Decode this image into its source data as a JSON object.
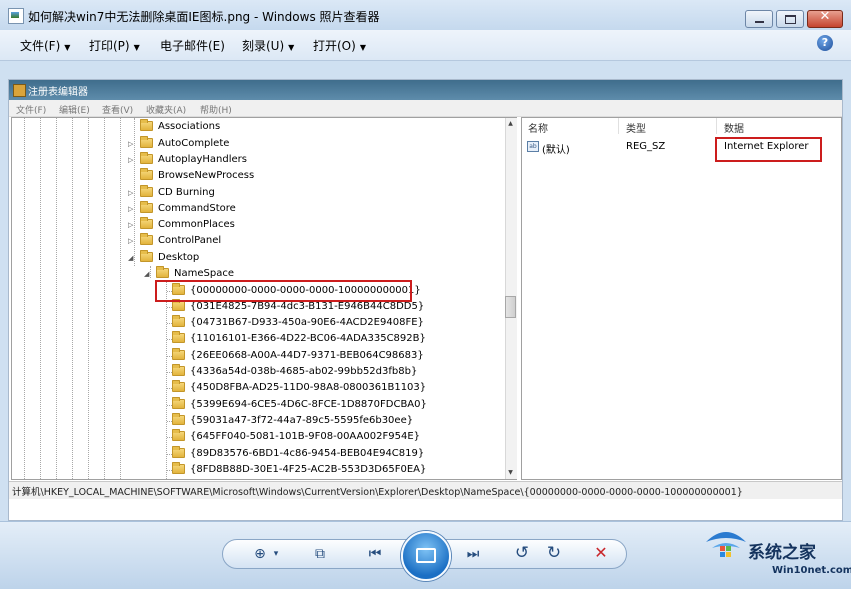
{
  "window": {
    "title": "如何解决win7中无法删除桌面IE图标.png - Windows 照片查看器",
    "close_glyph": "✕"
  },
  "menu": {
    "file": "文件(F)",
    "print": "打印(P)",
    "email": "电子邮件(E)",
    "burn": "刻录(U)",
    "open": "打开(O)",
    "arrow": "▼",
    "help": "?"
  },
  "registry": {
    "title": "注册表编辑器",
    "menu": [
      "文件(F)",
      "编辑(E)",
      "查看(V)",
      "收藏夹(A)",
      "帮助(H)"
    ],
    "tree_items": [
      "Associations",
      "AutoComplete",
      "AutoplayHandlers",
      "BrowseNewProcess",
      "CD Burning",
      "CommandStore",
      "CommonPlaces",
      "ControlPanel",
      "Desktop",
      "NameSpace",
      "{00000000-0000-0000-0000-100000000001}",
      "{031E4825-7B94-4dc3-B131-E946B44C8DD5}",
      "{04731B67-D933-450a-90E6-4ACD2E9408FE}",
      "{11016101-E366-4D22-BC06-4ADA335C892B}",
      "{26EE0668-A00A-44D7-9371-BEB064C98683}",
      "{4336a54d-038b-4685-ab02-99bb52d3fb8b}",
      "{450D8FBA-AD25-11D0-98A8-0800361B1103}",
      "{5399E694-6CE5-4D6C-8FCE-1D8870FDCBA0}",
      "{59031a47-3f72-44a7-89c5-5595fe6b30ee}",
      "{645FF040-5081-101B-9F08-00AA002F954E}",
      "{89D83576-6BD1-4c86-9454-BEB04E94C819}",
      "{8FD8B88D-30E1-4F25-AC2B-553D3D65F0EA}"
    ],
    "columns": {
      "name": "名称",
      "type": "类型",
      "data": "数据"
    },
    "value_row": {
      "icon": "ab",
      "name": "(默认)",
      "type": "REG_SZ",
      "data": "Internet Explorer"
    },
    "status_path": "计算机\\HKEY_LOCAL_MACHINE\\SOFTWARE\\Microsoft\\Windows\\CurrentVersion\\Explorer\\Desktop\\NameSpace\\{00000000-0000-0000-0000-100000000001}"
  },
  "controls": {
    "zoom": "⊕",
    "zoom_arrow": "▾",
    "actual_size": "⧉",
    "prev": "⏮",
    "next": "⏭",
    "rotate_ccw": "↺",
    "rotate_cw": "↻",
    "delete": "✕"
  },
  "watermark": {
    "name": "系统之家",
    "url": "Win10net.com"
  },
  "colors": {
    "highlight_box": "#cc1d1d",
    "brand": "#14335e"
  }
}
